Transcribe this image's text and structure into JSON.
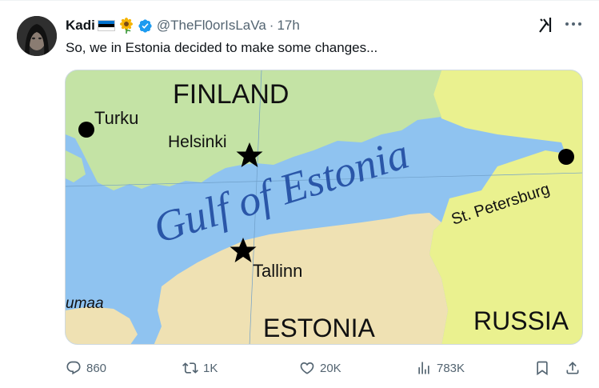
{
  "tweet": {
    "author_name": "Kadi",
    "handle": "@TheFl0orIsLaVa",
    "dot": "·",
    "time": "17h",
    "text": "So, we in Estonia decided to make some changes...",
    "flag_colors": [
      "#0072ce",
      "#000000",
      "#ffffff"
    ],
    "verified_color": "#1d9bf0"
  },
  "media": {
    "labels": {
      "finland": "FINLAND",
      "turku": "Turku",
      "helsinki": "Helsinki",
      "gulf": "Gulf of Estonia",
      "st_petersburg": "St. Petersburg",
      "tallinn": "Tallinn",
      "estonia": "ESTONIA",
      "russia": "RUSSIA",
      "umaa": "umaa"
    },
    "colors": {
      "sea": "#8fc3f0",
      "finland": "#c4e3a5",
      "estonia": "#efe1b3",
      "russia": "#eaf18f",
      "gulf_text": "#2a56a8"
    }
  },
  "actions": {
    "replies": "860",
    "reposts": "1K",
    "likes": "20K",
    "views": "783K"
  }
}
